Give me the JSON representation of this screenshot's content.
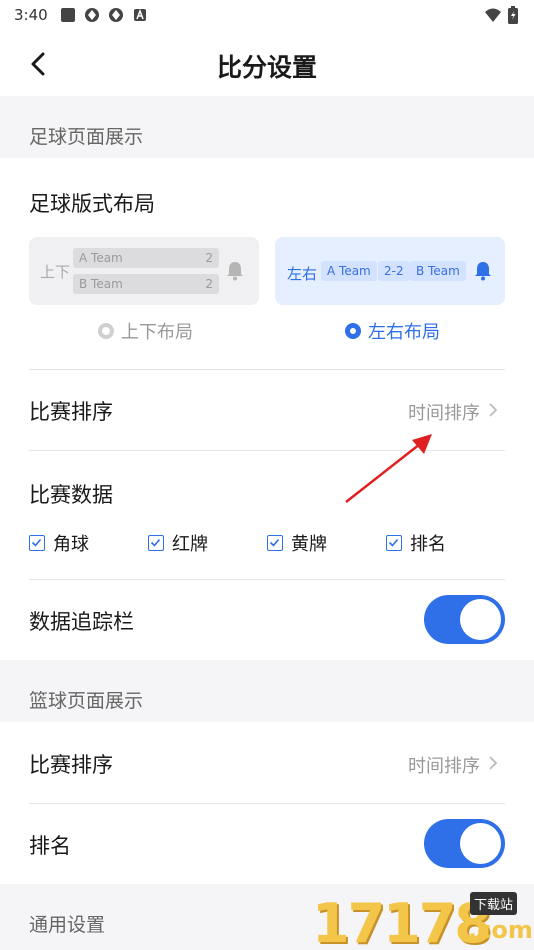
{
  "status_bar": {
    "time": "3:40"
  },
  "nav": {
    "title": "比分设置"
  },
  "football": {
    "section_title": "足球页面展示",
    "layout_title": "足球版式布局",
    "vertical_preview": {
      "label": "上下",
      "team_a": "A Team",
      "score_a": "2",
      "team_b": "B Team",
      "score_b": "2"
    },
    "horizontal_preview": {
      "label": "左右",
      "team_a": "A Team",
      "score": "2-2",
      "team_b": "B Team"
    },
    "option_vertical": "上下布局",
    "option_horizontal": "左右布局",
    "selected_layout": "horizontal",
    "sort_title": "比赛排序",
    "sort_value": "时间排序",
    "data_title": "比赛数据",
    "data_options": [
      {
        "label": "角球",
        "checked": true
      },
      {
        "label": "红牌",
        "checked": true
      },
      {
        "label": "黄牌",
        "checked": true
      },
      {
        "label": "排名",
        "checked": true
      }
    ],
    "tracker_title": "数据追踪栏",
    "tracker_on": true
  },
  "basketball": {
    "section_title": "篮球页面展示",
    "sort_title": "比赛排序",
    "sort_value": "时间排序",
    "rank_title": "排名",
    "rank_on": true
  },
  "general": {
    "section_title": "通用设置"
  },
  "watermark": {
    "text": "17178",
    "badge": "下载站",
    "suffix": ".com"
  },
  "colors": {
    "accent": "#2f6fe8",
    "annotation_arrow": "#e02020"
  }
}
